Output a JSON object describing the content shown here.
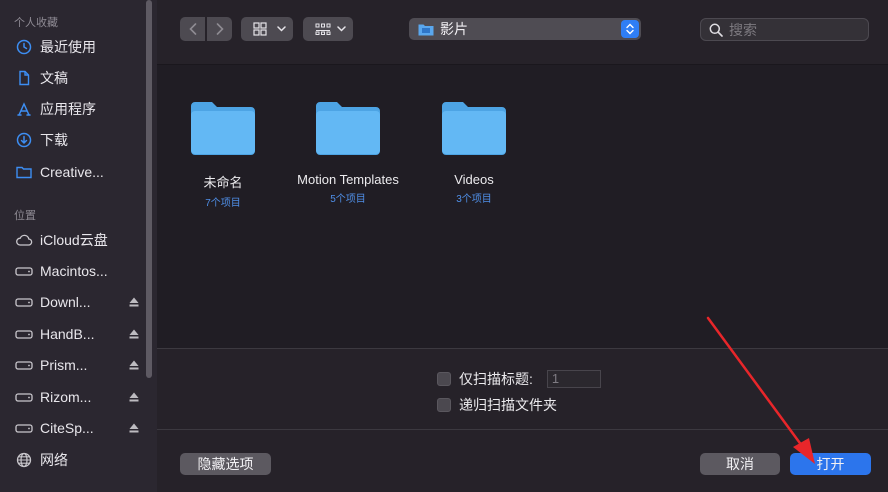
{
  "sidebar": {
    "favorites_title": "个人收藏",
    "favorites": [
      {
        "label": "最近使用",
        "icon": "clock-icon"
      },
      {
        "label": "文稿",
        "icon": "document-icon"
      },
      {
        "label": "应用程序",
        "icon": "applications-icon"
      },
      {
        "label": "下载",
        "icon": "download-icon"
      },
      {
        "label": "Creative...",
        "icon": "folder-icon"
      }
    ],
    "locations_title": "位置",
    "locations": [
      {
        "label": "iCloud云盘",
        "icon": "cloud-icon",
        "eject": false
      },
      {
        "label": "Macintos...",
        "icon": "disk-icon",
        "eject": false
      },
      {
        "label": "Downl...",
        "icon": "disk-icon",
        "eject": true
      },
      {
        "label": "HandB...",
        "icon": "disk-icon",
        "eject": true
      },
      {
        "label": "Prism...",
        "icon": "disk-icon",
        "eject": true
      },
      {
        "label": "Rizom...",
        "icon": "disk-icon",
        "eject": true
      },
      {
        "label": "CiteSp...",
        "icon": "disk-icon",
        "eject": true
      },
      {
        "label": "网络",
        "icon": "globe-icon",
        "eject": false
      }
    ]
  },
  "toolbar": {
    "path_label": "影片",
    "search_placeholder": "搜索"
  },
  "files": [
    {
      "name": "未命名",
      "count": "7个项目"
    },
    {
      "name": "Motion Templates",
      "count": "5个项目"
    },
    {
      "name": "Videos",
      "count": "3个项目"
    }
  ],
  "options": {
    "scan_titles_label": "仅扫描标题:",
    "scan_titles_value": "1",
    "recursive_label": "递归扫描文件夹"
  },
  "buttons": {
    "hide_options": "隐藏选项",
    "cancel": "取消",
    "open": "打开"
  },
  "colors": {
    "accent": "#2c75ec",
    "folder": "#5cb4f2",
    "annotation_arrow": "#e8262a"
  }
}
